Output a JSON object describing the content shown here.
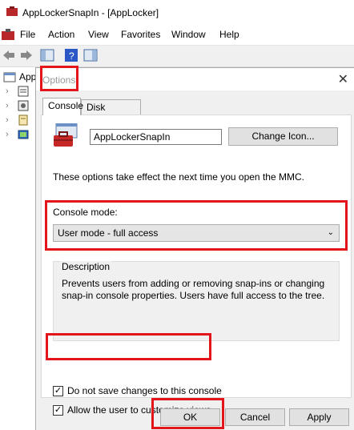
{
  "window": {
    "title": "AppLockerSnapIn - [AppLocker]",
    "menu": [
      "File",
      "Action",
      "View",
      "Favorites",
      "Window",
      "Help"
    ],
    "tree_first_label": "App"
  },
  "dialog": {
    "title": "Options",
    "close_glyph": "✕",
    "tabs": [
      "Console",
      "Disk Cleanup"
    ],
    "console_name": "AppLockerSnapIn",
    "change_icon_label": "Change Icon...",
    "info_text": "These options take effect the next time you open the MMC.",
    "console_mode_label": "Console mode:",
    "console_mode_value": "User mode - full access",
    "description_label": "Description",
    "description_text": "Prevents users from adding or removing snap-ins or changing snap-in console properties. Users have full access to the tree.",
    "checkbox1_label": "Do not save changes to this console",
    "checkbox1_checked": true,
    "checkbox2_label": "Allow the user to customize views",
    "checkbox2_checked": true,
    "ok_label": "OK",
    "cancel_label": "Cancel",
    "apply_label": "Apply"
  },
  "colors": {
    "highlight": "#e4141b",
    "dialog_bg": "#f0f0f0"
  }
}
